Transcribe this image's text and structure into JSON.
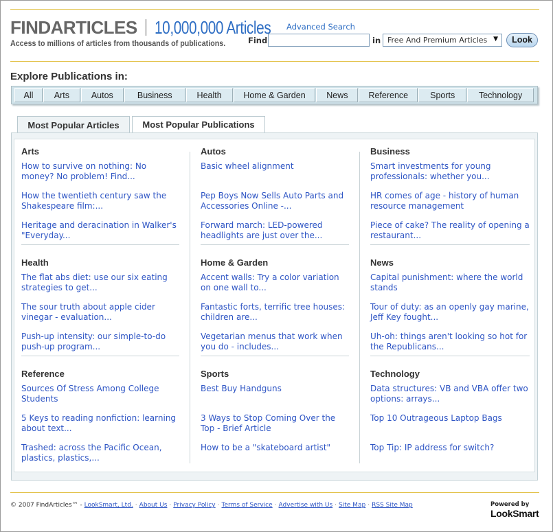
{
  "header": {
    "logo_name": "FINDARTICLES",
    "logo_count": "10,000,000 Articles",
    "tagline": "Access to millions of articles from thousands of publications.",
    "advanced_search": "Advanced Search",
    "find_label": "Find",
    "search_value": "",
    "in_label": "in",
    "scope_selected": "Free And Premium Articles",
    "look_button": "Look",
    "accent_color": "#2e6ec4",
    "rule_color": "#e3c34c"
  },
  "explore": {
    "title": "Explore Publications in:",
    "categories": [
      "All",
      "Arts",
      "Autos",
      "Business",
      "Health",
      "Home & Garden",
      "News",
      "Reference",
      "Sports",
      "Technology"
    ]
  },
  "tabs": [
    "Most Popular Articles",
    "Most Popular Publications"
  ],
  "sections": [
    {
      "title": "Arts",
      "links": [
        "How to survive on nothing: No money? No problem! Find...",
        "How the twentieth century saw the Shakespeare film:...",
        "Heritage and deracination in Walker's \"Everyday..."
      ]
    },
    {
      "title": "Autos",
      "links": [
        "Basic wheel alignment",
        "Pep Boys Now Sells Auto Parts and Accessories Online -...",
        "Forward march: LED-powered headlights are just over the..."
      ]
    },
    {
      "title": "Business",
      "links": [
        "Smart investments for young professionals: whether you...",
        "HR comes of age - history of human resource management",
        "Piece of cake? The reality of opening a restaurant..."
      ]
    },
    {
      "title": "Health",
      "links": [
        "The flat abs diet: use our six eating strategies to get...",
        "The sour truth about apple cider vinegar - evaluation...",
        "Push-up intensity: our simple-to-do push-up program..."
      ]
    },
    {
      "title": "Home & Garden",
      "links": [
        "Accent walls: Try a color variation on one wall to...",
        "Fantastic forts, terrific tree houses: children are...",
        "Vegetarian menus that work when you do - includes..."
      ]
    },
    {
      "title": "News",
      "links": [
        "Capital punishment: where the world stands",
        "Tour of duty: as an openly gay marine, Jeff Key fought...",
        "Uh-oh: things aren't looking so hot for the Republicans..."
      ]
    },
    {
      "title": "Reference",
      "links": [
        "Sources Of Stress Among College Students",
        "5 Keys to reading nonfiction: learning about text...",
        "Trashed: across the Pacific Ocean, plastics, plastics,..."
      ]
    },
    {
      "title": "Sports",
      "links": [
        "Best Buy Handguns",
        "3 Ways to Stop Coming Over the Top - Brief Article",
        "How to be a \"skateboard artist\""
      ]
    },
    {
      "title": "Technology",
      "links": [
        "Data structures: VB and VBA offer two options: arrays...",
        "Top 10 Outrageous Laptop Bags",
        "Top Tip: IP address for switch?"
      ]
    }
  ],
  "footer": {
    "copyright": "© 2007 FindArticles™ -",
    "links": [
      "LookSmart, Ltd.",
      "About Us",
      "Privacy Policy",
      "Terms of Service",
      "Advertise with Us",
      "Site Map",
      "RSS Site Map"
    ],
    "powered_by": "Powered by",
    "powered_logo": "LookSmart"
  }
}
